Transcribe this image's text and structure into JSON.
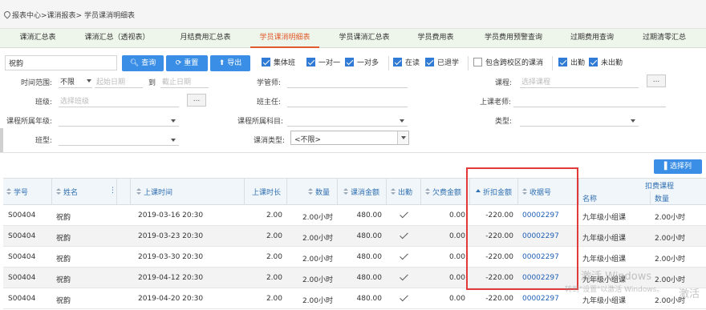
{
  "breadcrumb": "报表中心>课消报表> 学员课消明细表",
  "tabs": [
    "课消汇总表",
    "课消汇总（透视表）",
    "月结费用汇总表",
    "学员课消明细表",
    "学员课消汇总表",
    "学员费用表",
    "学员费用预警查询",
    "过期费用查询",
    "过期清零汇总"
  ],
  "search": {
    "name_value": "祝韵",
    "query_label": "查询",
    "reset_label": "重置",
    "export_label": "导出"
  },
  "checkboxes": {
    "group_class": "集体班",
    "one_on_one": "一对一",
    "one_to_many": "一对多",
    "enrolled": "在读",
    "graduated": "已退学",
    "cross_campus": "包含跨校区的课消",
    "attended": "出勤",
    "absent": "未出勤"
  },
  "filters": {
    "time_range_label": "时间范围:",
    "time_unlimited": "不限",
    "start_date_placeholder": "起始日期",
    "to": "到",
    "end_date_placeholder": "截止日期",
    "teacher_label": "学管师:",
    "course_label": "课程:",
    "course_placeholder": "选择课程",
    "class_label": "班级:",
    "class_placeholder": "选择班级",
    "head_teacher_label": "班主任:",
    "lesson_teacher_label": "上课老师:",
    "grade_label": "课程所属年级:",
    "subject_label": "课程所属科目:",
    "type_label": "类型:",
    "class_type_label": "班型:",
    "consume_type_label": "课消类型:",
    "consume_type_value": "<不限>",
    "ellipsis": "..."
  },
  "column_button": "选择列",
  "deduct_course_header": "扣费课程",
  "columns": {
    "student_no": "学号",
    "name": "姓名",
    "time": "上课时间",
    "duration": "上课时长",
    "quantity": "数量",
    "amount": "课消金额",
    "attendance": "出勤",
    "owed": "欠费金额",
    "discount": "折扣金额",
    "receipt": "收据号",
    "course_name": "名称",
    "course_qty": "数量"
  },
  "rows": [
    {
      "student_no": "S00404",
      "name": "祝韵",
      "time": "2019-03-16 20:30",
      "duration": "2.00",
      "quantity": "2.00小时",
      "amount": "480.00",
      "owed": "0.00",
      "discount": "-220.00",
      "receipt": "00002297",
      "course_name": "九年级小组课",
      "course_qty": "2.00小时"
    },
    {
      "student_no": "S00404",
      "name": "祝韵",
      "time": "2019-03-23 20:30",
      "duration": "2.00",
      "quantity": "2.00小时",
      "amount": "480.00",
      "owed": "0.00",
      "discount": "-220.00",
      "receipt": "00002297",
      "course_name": "九年级小组课",
      "course_qty": "2.00小时"
    },
    {
      "student_no": "S00404",
      "name": "祝韵",
      "time": "2019-03-30 20:30",
      "duration": "2.00",
      "quantity": "2.00小时",
      "amount": "480.00",
      "owed": "0.00",
      "discount": "-220.00",
      "receipt": "00002297",
      "course_name": "九年级小组课",
      "course_qty": "2.00小时"
    },
    {
      "student_no": "S00404",
      "name": "祝韵",
      "time": "2019-04-12 20:30",
      "duration": "2.00",
      "quantity": "2.00小时",
      "amount": "480.00",
      "owed": "0.00",
      "discount": "-220.00",
      "receipt": "00002297",
      "course_name": "九年级小组课",
      "course_qty": "2.00小时"
    },
    {
      "student_no": "S00404",
      "name": "祝韵",
      "time": "2019-04-20 20:30",
      "duration": "2.00",
      "quantity": "2.00小时",
      "amount": "480.00",
      "owed": "0.00",
      "discount": "-220.00",
      "receipt": "00002297",
      "course_name": "九年级小组课",
      "course_qty": "2.00小时"
    }
  ],
  "watermark": {
    "line1": "激活 Windows",
    "line2": "转到\"设置\"以激活 Windows。",
    "corner": "激活"
  }
}
